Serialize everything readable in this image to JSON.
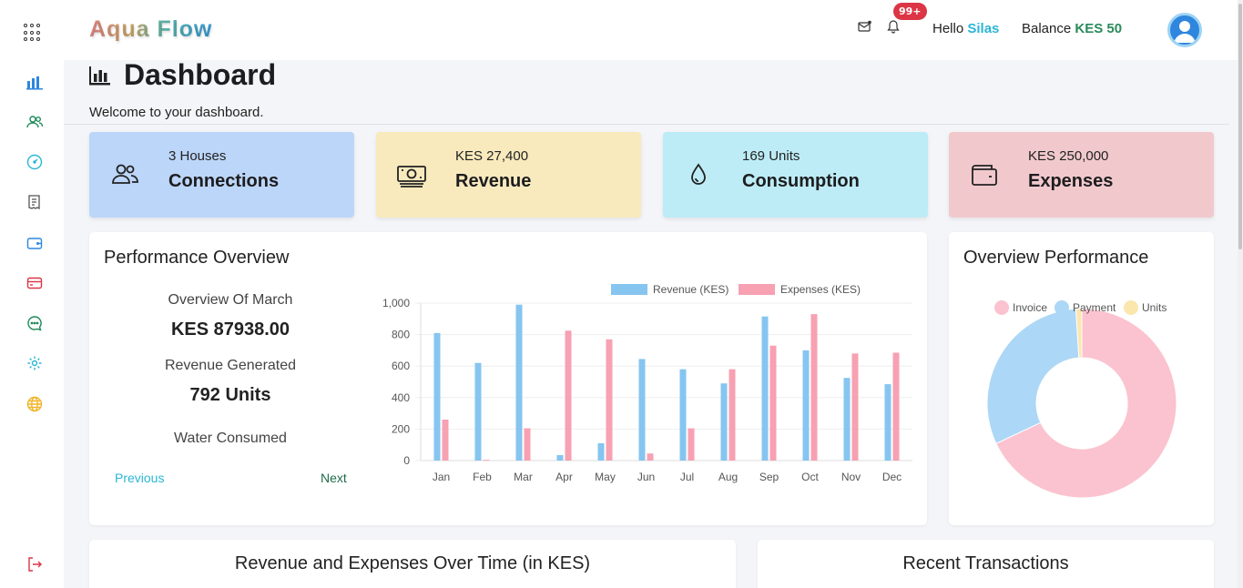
{
  "app": {
    "brand": "Aqua Flow"
  },
  "header": {
    "notification_count": "99+",
    "greeting": "Hello",
    "user_name": "Silas",
    "balance_label": "Balance",
    "balance_value": "KES 50"
  },
  "page": {
    "title": "Dashboard",
    "welcome": "Welcome to your dashboard."
  },
  "cards": [
    {
      "sub": "3 Houses",
      "label": "Connections",
      "bg": "#bcd6f9",
      "icon": "users-icon"
    },
    {
      "sub": "KES 27,400",
      "label": "Revenue",
      "bg": "#f8eabd",
      "icon": "money-icon"
    },
    {
      "sub": "169 Units",
      "label": "Consumption",
      "bg": "#bdecf6",
      "icon": "water-drop-icon"
    },
    {
      "sub": "KES 250,000",
      "label": "Expenses",
      "bg": "#f1c9cd",
      "icon": "wallet-icon"
    }
  ],
  "performance": {
    "title": "Performance Overview",
    "overview_label": "Overview Of March",
    "revenue_value": "KES 87938.00",
    "revenue_label": "Revenue Generated",
    "units_value": "792 Units",
    "water_label": "Water Consumed",
    "prev_label": "Previous",
    "next_label": "Next"
  },
  "donut_panel": {
    "title": "Overview Performance"
  },
  "bottom": {
    "left_title": "Revenue and Expenses Over Time (in KES)",
    "right_title": "Recent Transactions"
  },
  "chart_data": [
    {
      "type": "bar",
      "categories": [
        "Jan",
        "Feb",
        "Mar",
        "Apr",
        "May",
        "Jun",
        "Jul",
        "Aug",
        "Sep",
        "Oct",
        "Nov",
        "Dec"
      ],
      "series": [
        {
          "name": "Revenue (KES)",
          "color": "#86c5f0",
          "values": [
            810,
            620,
            990,
            35,
            110,
            645,
            580,
            490,
            915,
            700,
            525,
            485
          ]
        },
        {
          "name": "Expenses (KES)",
          "color": "#f7a1b3",
          "values": [
            260,
            5,
            205,
            825,
            770,
            45,
            205,
            580,
            730,
            930,
            680,
            685
          ]
        }
      ],
      "ylim": [
        0,
        1000
      ],
      "yticks": [
        "0",
        "200",
        "400",
        "600",
        "800",
        "1,000"
      ],
      "legend": "top"
    },
    {
      "type": "pie",
      "labels": [
        "Invoice",
        "Payment",
        "Units"
      ],
      "colors": [
        "#fbc3cf",
        "#acd7f6",
        "#fbe6ad"
      ],
      "values": [
        68,
        31,
        1
      ],
      "legend": "top"
    }
  ],
  "icons": {
    "sidebar": [
      "bar-chart-icon",
      "users-icon",
      "dashboard-gauge-icon",
      "receipt-icon",
      "wallet-icon",
      "credit-card-icon",
      "chat-icon",
      "settings-icon",
      "globe-icon",
      "logout-icon"
    ]
  }
}
